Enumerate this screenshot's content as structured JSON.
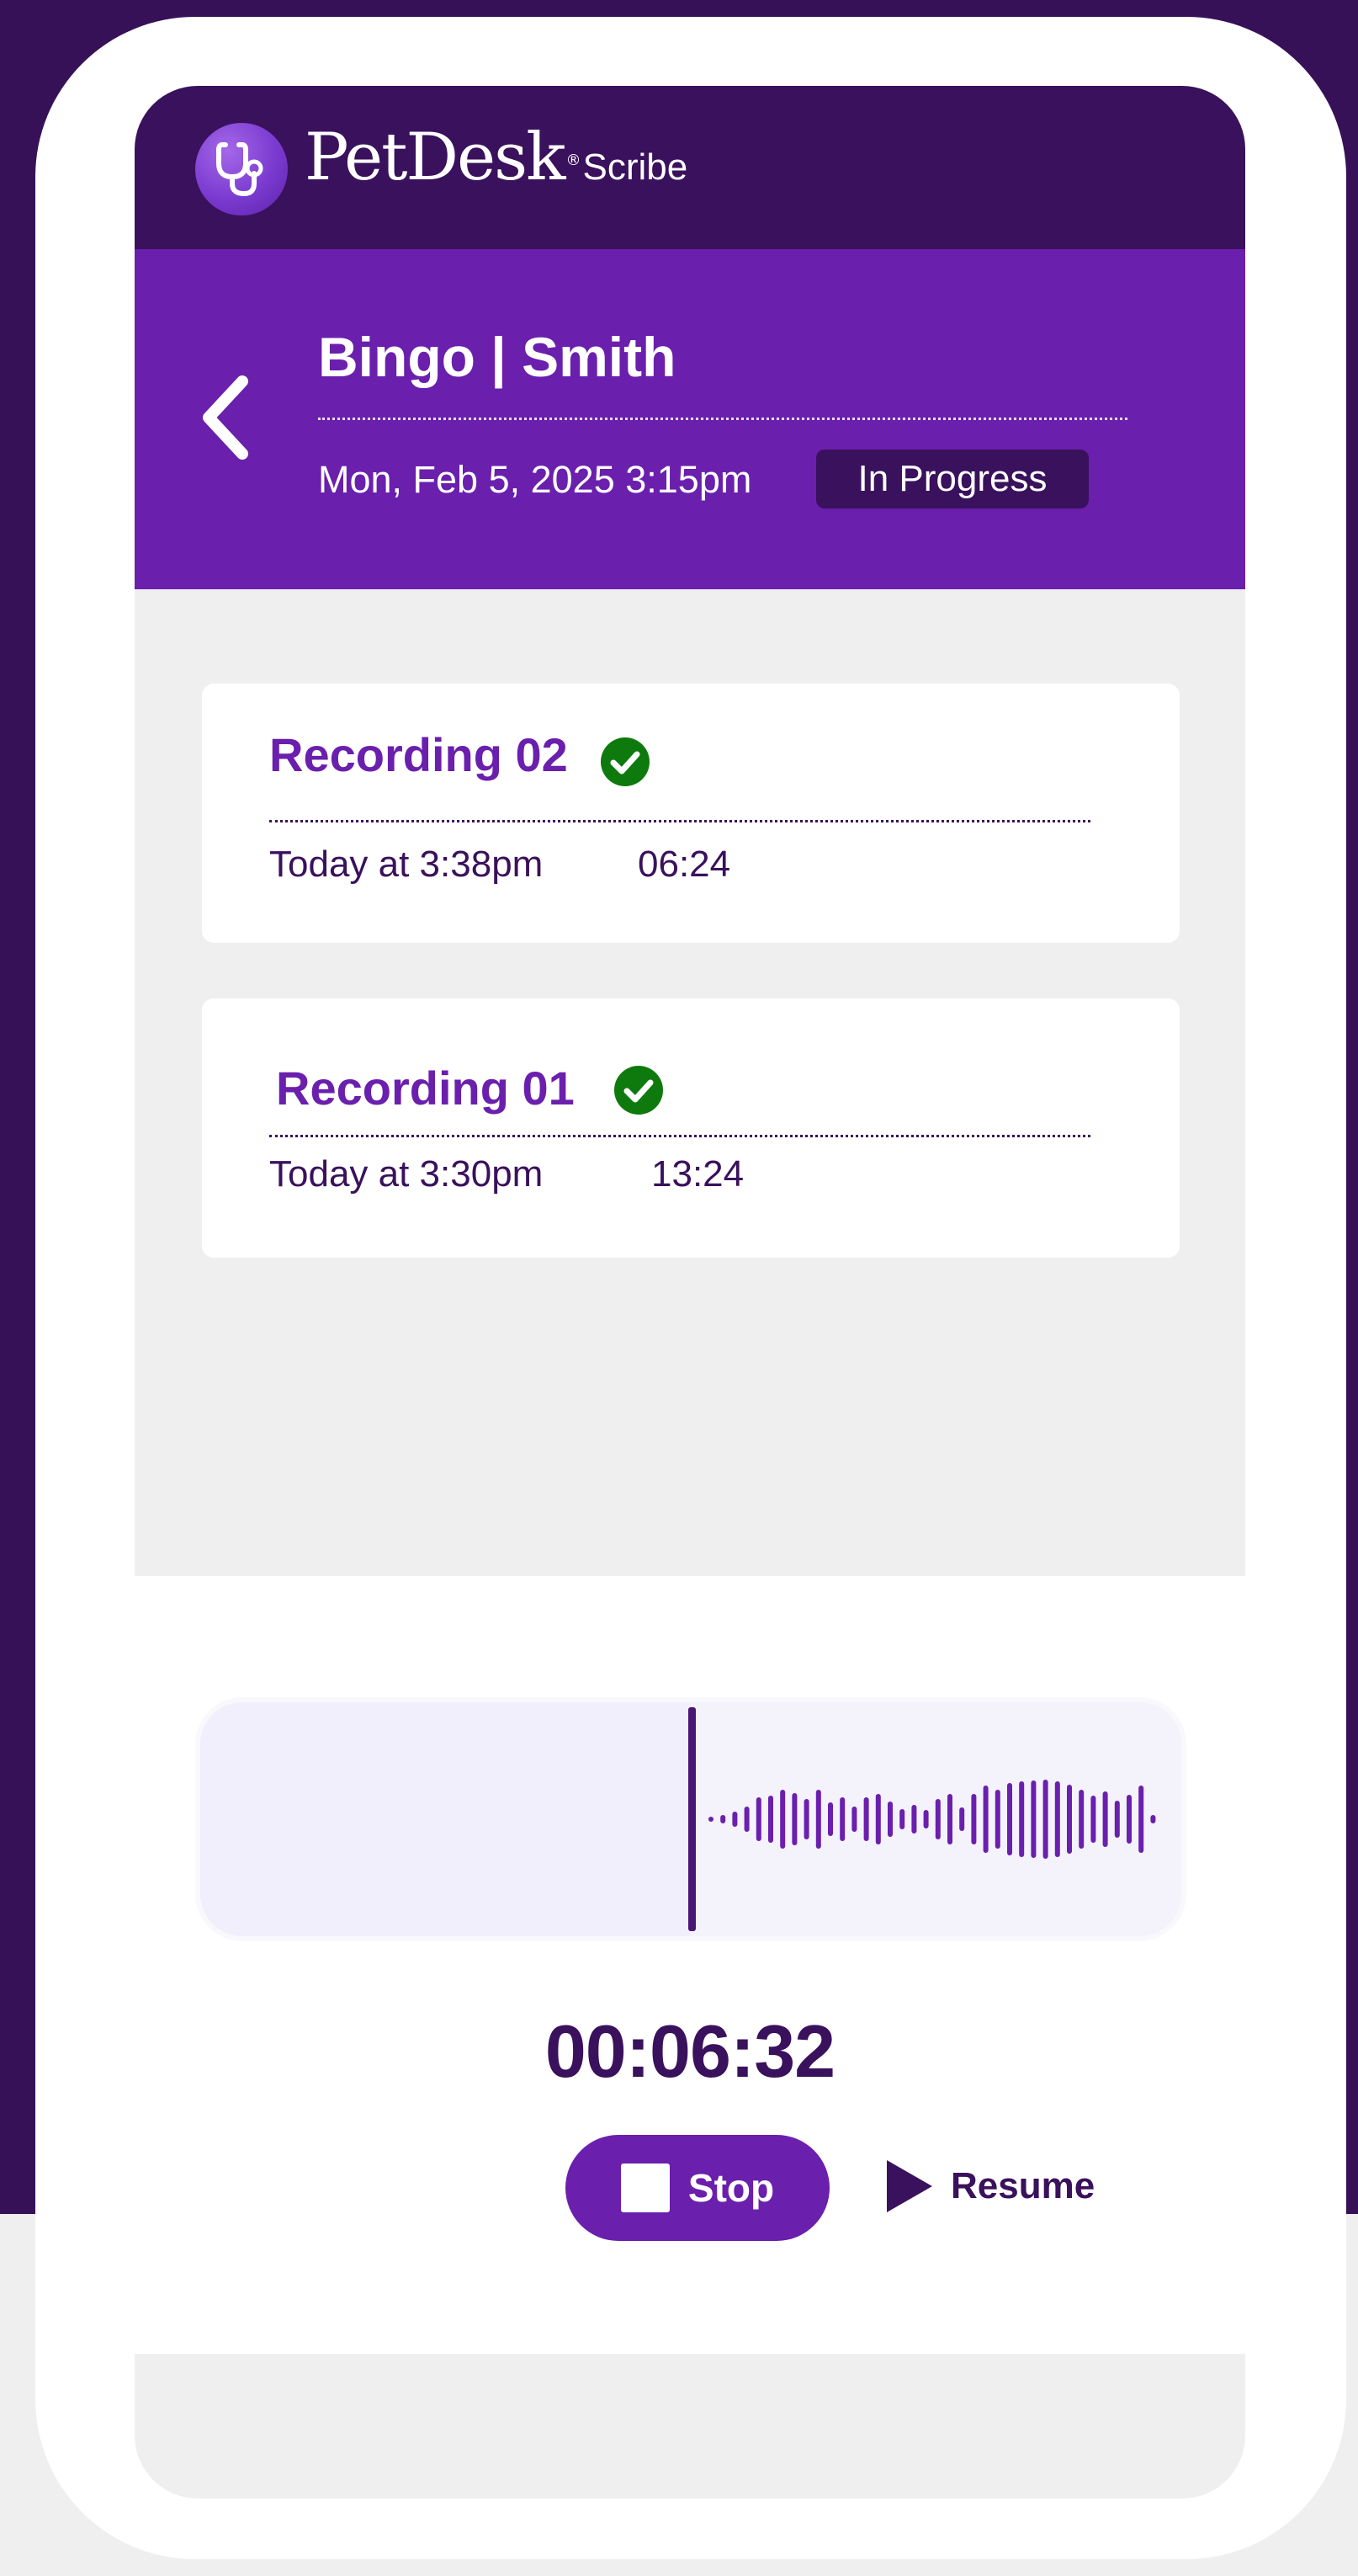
{
  "brand": {
    "name": "PetDesk",
    "registered_mark": "®",
    "product": "Scribe"
  },
  "header": {
    "title": "Bingo | Smith",
    "date": "Mon, Feb 5, 2025 3:15pm",
    "status": "In Progress"
  },
  "recordings": [
    {
      "title": "Recording 02",
      "date": "Today at 3:38pm",
      "duration": "06:24",
      "status_icon": "check-circle-icon"
    },
    {
      "title": "Recording 01",
      "date": "Today at 3:30pm",
      "duration": "13:24",
      "status_icon": "check-circle-icon"
    }
  ],
  "player": {
    "timer": "00:06:32",
    "stop_label": "Stop",
    "resume_label": "Resume"
  },
  "colors": {
    "dark_purple": "#3a115c",
    "purple": "#6a1fad",
    "success_green": "#0e7a0d",
    "background_gray": "#efefef"
  }
}
